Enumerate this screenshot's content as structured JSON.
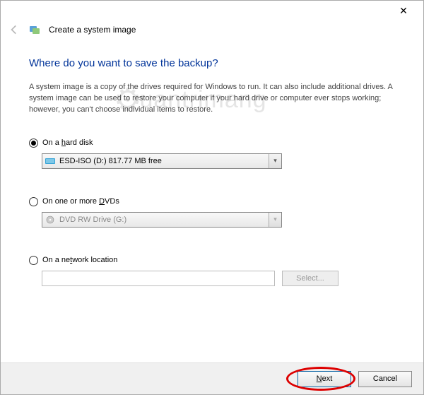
{
  "window": {
    "title": "Create a system image",
    "close_glyph": "✕"
  },
  "heading": "Where do you want to save the backup?",
  "description": "A system image is a copy of the drives required for Windows to run. It can also include additional drives. A system image can be used to restore your computer if your hard drive or computer ever stops working; however, you can't choose individual items to restore.",
  "options": {
    "hard_disk": {
      "label_pre": "On a ",
      "label_u": "h",
      "label_post": "ard disk",
      "selected_value": "ESD-ISO (D:)  817.77 MB free"
    },
    "dvds": {
      "label_pre": "On one or more ",
      "label_u": "D",
      "label_post": "VDs",
      "selected_value": "DVD RW Drive (G:)"
    },
    "network": {
      "label_pre": "On a ne",
      "label_u": "t",
      "label_post": "work location",
      "select_btn": "Select..."
    }
  },
  "footer": {
    "next_u": "N",
    "next_rest": "ext",
    "cancel": "Cancel"
  },
  "watermark": "uantrimang"
}
